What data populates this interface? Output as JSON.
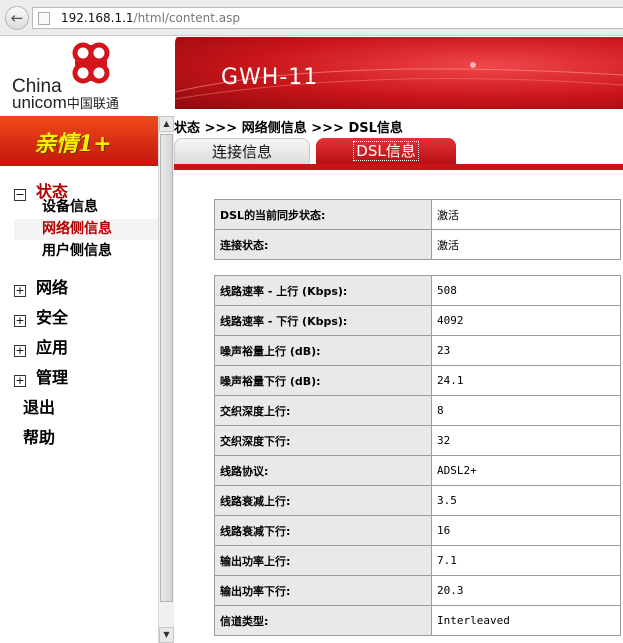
{
  "browser": {
    "url_host": "192.168.1.1",
    "url_path": "/html/content.asp"
  },
  "logo": {
    "line1": "China",
    "line2": "unicom",
    "cn": "中国联通"
  },
  "banner": {
    "title": "GWH-11"
  },
  "promo": {
    "text": "亲情1+"
  },
  "sidebar": {
    "groups": [
      {
        "label": "状态",
        "box": "−"
      },
      {
        "label": "网络",
        "box": "+"
      },
      {
        "label": "安全",
        "box": "+"
      },
      {
        "label": "应用",
        "box": "+"
      },
      {
        "label": "管理",
        "box": "+"
      }
    ],
    "status_items": [
      "设备信息",
      "网络侧信息",
      "用户侧信息"
    ],
    "logout": "退出",
    "help": "帮助"
  },
  "breadcrumb": "状态 >>> 网络侧信息 >>> DSL信息",
  "tabs": {
    "connection": "连接信息",
    "dsl": "DSL信息"
  },
  "table1": [
    {
      "label": "DSL的当前同步状态:",
      "value": "激活"
    },
    {
      "label": "连接状态:",
      "value": "激活"
    }
  ],
  "table2": [
    {
      "label": "线路速率 - 上行 (Kbps):",
      "value": "508"
    },
    {
      "label": "线路速率 - 下行 (Kbps):",
      "value": "4092"
    },
    {
      "label": "噪声裕量上行 (dB):",
      "value": "23"
    },
    {
      "label": "噪声裕量下行 (dB):",
      "value": "24.1"
    },
    {
      "label": "交织深度上行:",
      "value": "8"
    },
    {
      "label": "交织深度下行:",
      "value": "32"
    },
    {
      "label": "线路协议:",
      "value": "ADSL2+"
    },
    {
      "label": "线路衰减上行:",
      "value": "3.5"
    },
    {
      "label": "线路衰减下行:",
      "value": "16"
    },
    {
      "label": "输出功率上行:",
      "value": "7.1"
    },
    {
      "label": "输出功率下行:",
      "value": "20.3"
    },
    {
      "label": "信道类型:",
      "value": "Interleaved"
    }
  ],
  "colors": {
    "brand_red": "#c81419",
    "active_text": "#b00000"
  }
}
